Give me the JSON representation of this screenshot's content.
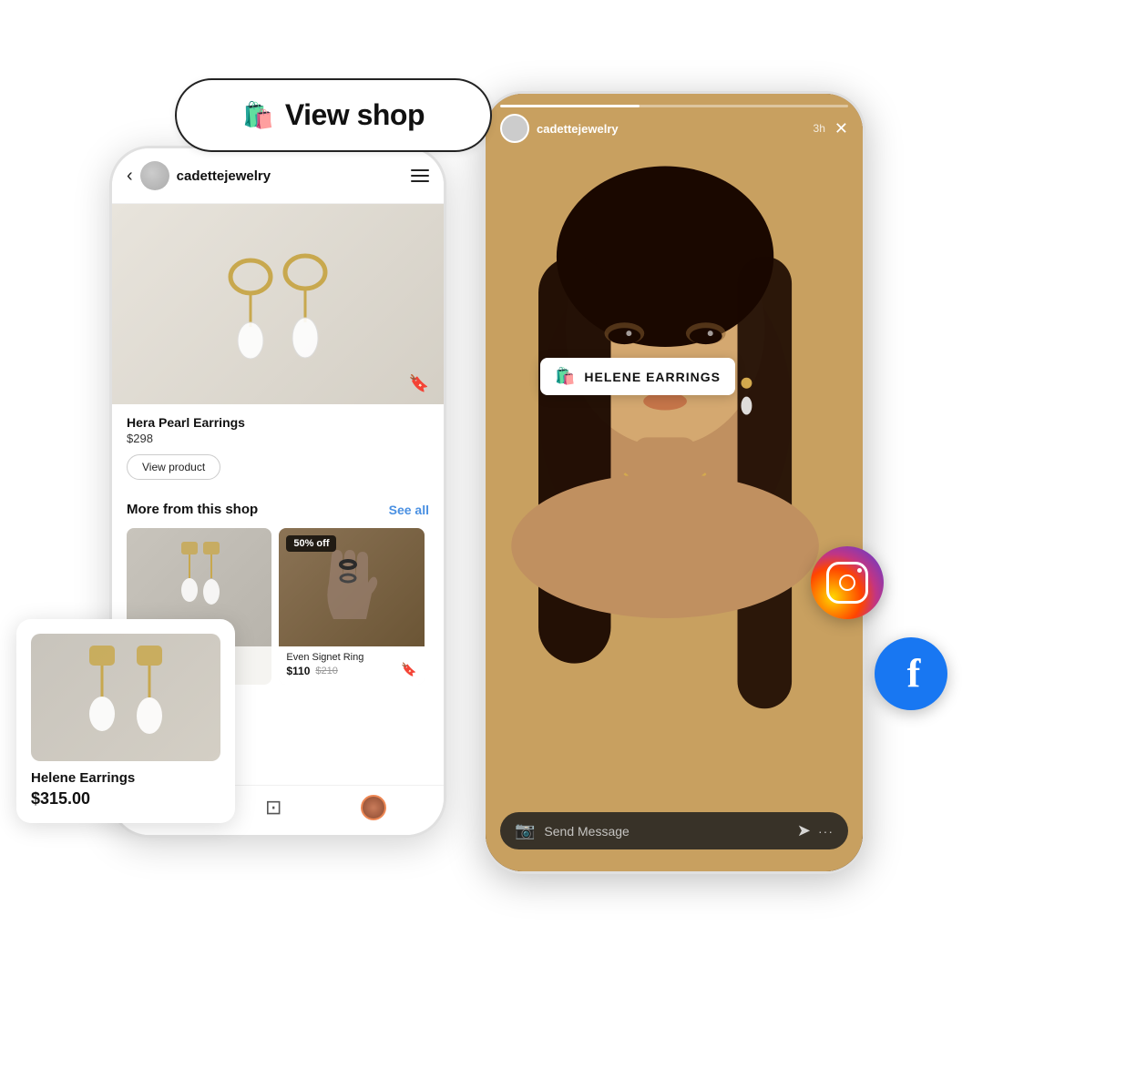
{
  "view_shop": {
    "label": "View shop",
    "icon": "🛍️"
  },
  "left_phone": {
    "shop_name": "cadettejewelry",
    "product": {
      "name": "Hera Pearl Earrings",
      "price": "$298",
      "view_button": "View product"
    },
    "more_section": {
      "title": "More from this shop",
      "see_all": "See all"
    },
    "grid_items": [
      {
        "name": "Helene Earrings",
        "price": "$110",
        "original_price": "$210",
        "discount": "50% off"
      }
    ]
  },
  "product_card": {
    "name": "Helene Earrings",
    "price": "$315.00"
  },
  "right_phone": {
    "username": "cadettejewelry",
    "time": "3h",
    "product_tag": "HELENE EARRINGS",
    "send_message_placeholder": "Send Message"
  },
  "social_badges": {
    "instagram": "Instagram",
    "facebook": "Facebook"
  }
}
